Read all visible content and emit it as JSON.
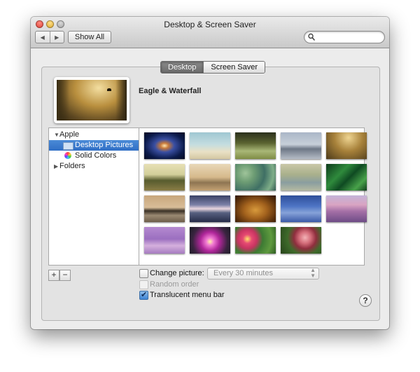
{
  "window": {
    "title": "Desktop & Screen Saver"
  },
  "toolbar": {
    "back_icon": "◀",
    "forward_icon": "▶",
    "show_all_label": "Show All",
    "search_placeholder": ""
  },
  "tabs": [
    {
      "label": "Desktop",
      "selected": true
    },
    {
      "label": "Screen Saver",
      "selected": false
    }
  ],
  "current_wallpaper": {
    "name": "Eagle & Waterfall"
  },
  "sources": [
    {
      "label": "Apple",
      "expanded": true,
      "indent": 0
    },
    {
      "label": "Desktop Pictures",
      "selected": true,
      "indent": 1,
      "icon": "folder-icon"
    },
    {
      "label": "Solid Colors",
      "indent": 1,
      "icon": "color-wheel-icon"
    },
    {
      "label": "Folders",
      "expanded": false,
      "indent": 0
    }
  ],
  "source_buttons": {
    "add_label": "+",
    "remove_label": "−"
  },
  "wallpapers": [
    {
      "name": "galaxy"
    },
    {
      "name": "beach"
    },
    {
      "name": "grass-field"
    },
    {
      "name": "misty-lake"
    },
    {
      "name": "eagle-waterfall",
      "selected": true
    },
    {
      "name": "elephant"
    },
    {
      "name": "zebras"
    },
    {
      "name": "lily-pads"
    },
    {
      "name": "grass-field-pastel"
    },
    {
      "name": "green-leaves"
    },
    {
      "name": "island"
    },
    {
      "name": "dusk-lake"
    },
    {
      "name": "lion"
    },
    {
      "name": "blue-moon"
    },
    {
      "name": "mountain-fuji"
    },
    {
      "name": "purple-haze"
    },
    {
      "name": "lotus-flower"
    },
    {
      "name": "pink-flowers"
    },
    {
      "name": "berries"
    }
  ],
  "options": {
    "change_picture_label": "Change picture:",
    "change_picture_checked": false,
    "interval_value": "Every 30 minutes",
    "random_order_label": "Random order",
    "random_order_checked": false,
    "translucent_label": "Translucent menu bar",
    "translucent_checked": true
  },
  "help_label": "?",
  "colors": {
    "selection": "#3a7bd5",
    "tab_selected": "#7a7a7a"
  }
}
